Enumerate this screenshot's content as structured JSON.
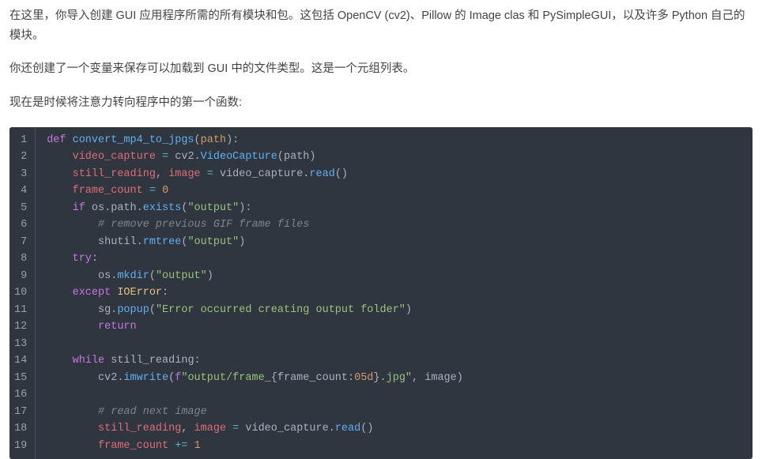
{
  "paragraphs": {
    "p1": "在这里，你导入创建 GUI 应用程序所需的所有模块和包。这包括 OpenCV (cv2)、Pillow 的 Image clas 和 PySimpleGUI，以及许多 Python 自己的模块。",
    "p2": "你还创建了一个变量来保存可以加载到 GUI 中的文件类型。这是一个元组列表。",
    "p3": "现在是时候将注意力转向程序中的第一个函数:"
  },
  "code": {
    "lines": [
      {
        "n": "1",
        "t": [
          {
            "c": "kw",
            "v": "def "
          },
          {
            "c": "fn",
            "v": "convert_mp4_to_jpgs"
          },
          {
            "c": "plain",
            "v": "("
          },
          {
            "c": "param",
            "v": "path"
          },
          {
            "c": "plain",
            "v": "):"
          }
        ],
        "indent": 0
      },
      {
        "n": "2",
        "t": [
          {
            "c": "ident",
            "v": "video_capture"
          },
          {
            "c": "plain",
            "v": " "
          },
          {
            "c": "op",
            "v": "="
          },
          {
            "c": "plain",
            "v": " cv2."
          },
          {
            "c": "member",
            "v": "VideoCapture"
          },
          {
            "c": "plain",
            "v": "(path)"
          }
        ],
        "indent": 1
      },
      {
        "n": "3",
        "t": [
          {
            "c": "ident",
            "v": "still_reading"
          },
          {
            "c": "plain",
            "v": ", "
          },
          {
            "c": "ident",
            "v": "image"
          },
          {
            "c": "plain",
            "v": " "
          },
          {
            "c": "op",
            "v": "="
          },
          {
            "c": "plain",
            "v": " video_capture."
          },
          {
            "c": "member",
            "v": "read"
          },
          {
            "c": "plain",
            "v": "()"
          }
        ],
        "indent": 1
      },
      {
        "n": "4",
        "t": [
          {
            "c": "ident",
            "v": "frame_count"
          },
          {
            "c": "plain",
            "v": " "
          },
          {
            "c": "op",
            "v": "="
          },
          {
            "c": "plain",
            "v": " "
          },
          {
            "c": "num",
            "v": "0"
          }
        ],
        "indent": 1
      },
      {
        "n": "5",
        "t": [
          {
            "c": "kw",
            "v": "if"
          },
          {
            "c": "plain",
            "v": " os.path."
          },
          {
            "c": "member",
            "v": "exists"
          },
          {
            "c": "plain",
            "v": "("
          },
          {
            "c": "str",
            "v": "\"output\""
          },
          {
            "c": "plain",
            "v": "):"
          }
        ],
        "indent": 1
      },
      {
        "n": "6",
        "t": [
          {
            "c": "comment",
            "v": "# remove previous GIF frame files"
          }
        ],
        "indent": 2
      },
      {
        "n": "7",
        "t": [
          {
            "c": "plain",
            "v": "shutil."
          },
          {
            "c": "member",
            "v": "rmtree"
          },
          {
            "c": "plain",
            "v": "("
          },
          {
            "c": "str",
            "v": "\"output\""
          },
          {
            "c": "plain",
            "v": ")"
          }
        ],
        "indent": 2
      },
      {
        "n": "8",
        "t": [
          {
            "c": "kw",
            "v": "try"
          },
          {
            "c": "plain",
            "v": ":"
          }
        ],
        "indent": 1
      },
      {
        "n": "9",
        "t": [
          {
            "c": "plain",
            "v": "os."
          },
          {
            "c": "member",
            "v": "mkdir"
          },
          {
            "c": "plain",
            "v": "("
          },
          {
            "c": "str",
            "v": "\"output\""
          },
          {
            "c": "plain",
            "v": ")"
          }
        ],
        "indent": 2
      },
      {
        "n": "10",
        "t": [
          {
            "c": "kw",
            "v": "except"
          },
          {
            "c": "plain",
            "v": " "
          },
          {
            "c": "cls",
            "v": "IOError"
          },
          {
            "c": "plain",
            "v": ":"
          }
        ],
        "indent": 1
      },
      {
        "n": "11",
        "t": [
          {
            "c": "plain",
            "v": "sg."
          },
          {
            "c": "member",
            "v": "popup"
          },
          {
            "c": "plain",
            "v": "("
          },
          {
            "c": "str",
            "v": "\"Error occurred creating output folder\""
          },
          {
            "c": "plain",
            "v": ")"
          }
        ],
        "indent": 2
      },
      {
        "n": "12",
        "t": [
          {
            "c": "kw",
            "v": "return"
          }
        ],
        "indent": 2
      },
      {
        "n": "13",
        "t": [],
        "indent": 0
      },
      {
        "n": "14",
        "t": [
          {
            "c": "kw",
            "v": "while"
          },
          {
            "c": "plain",
            "v": " still_reading:"
          }
        ],
        "indent": 1
      },
      {
        "n": "15",
        "t": [
          {
            "c": "plain",
            "v": "cv2."
          },
          {
            "c": "member",
            "v": "imwrite"
          },
          {
            "c": "plain",
            "v": "("
          },
          {
            "c": "kw",
            "v": "f"
          },
          {
            "c": "str",
            "v": "\"output/frame_"
          },
          {
            "c": "plain",
            "v": "{frame_count:"
          },
          {
            "c": "num",
            "v": "05d"
          },
          {
            "c": "plain",
            "v": "}"
          },
          {
            "c": "str",
            "v": ".jpg\""
          },
          {
            "c": "plain",
            "v": ", image)"
          }
        ],
        "indent": 2
      },
      {
        "n": "16",
        "t": [],
        "indent": 0
      },
      {
        "n": "17",
        "t": [
          {
            "c": "comment",
            "v": "# read next image"
          }
        ],
        "indent": 2
      },
      {
        "n": "18",
        "t": [
          {
            "c": "ident",
            "v": "still_reading"
          },
          {
            "c": "plain",
            "v": ", "
          },
          {
            "c": "ident",
            "v": "image"
          },
          {
            "c": "plain",
            "v": " "
          },
          {
            "c": "op",
            "v": "="
          },
          {
            "c": "plain",
            "v": " video_capture."
          },
          {
            "c": "member",
            "v": "read"
          },
          {
            "c": "plain",
            "v": "()"
          }
        ],
        "indent": 2
      },
      {
        "n": "19",
        "t": [
          {
            "c": "ident",
            "v": "frame_count"
          },
          {
            "c": "plain",
            "v": " "
          },
          {
            "c": "op",
            "v": "+="
          },
          {
            "c": "plain",
            "v": " "
          },
          {
            "c": "num",
            "v": "1"
          }
        ],
        "indent": 2
      }
    ]
  }
}
